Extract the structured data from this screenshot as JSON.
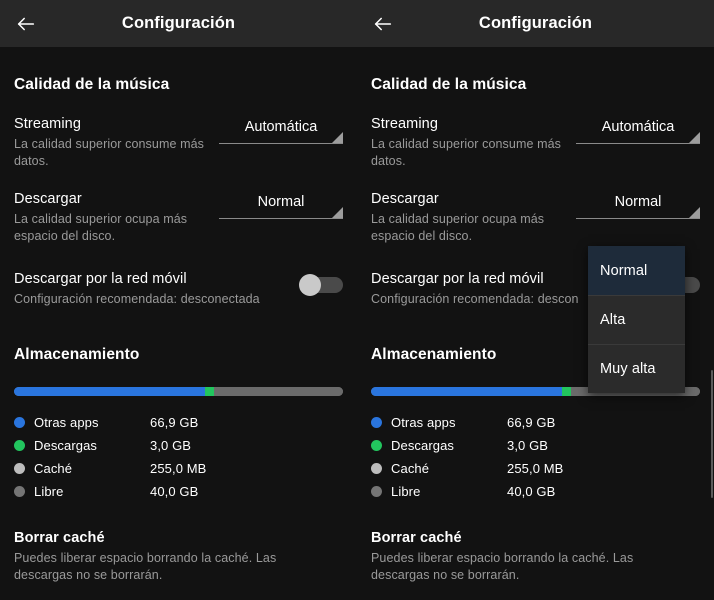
{
  "appbar": {
    "title": "Configuración",
    "back_icon": "arrow-left-icon"
  },
  "quality": {
    "section_title": "Calidad de la música",
    "rows": [
      {
        "title": "Streaming",
        "subtitle": "La calidad superior consume más datos.",
        "value": "Automática"
      },
      {
        "title": "Descargar",
        "subtitle": "La calidad superior ocupa más espacio del disco.",
        "value": "Normal"
      }
    ],
    "mobile_row": {
      "title": "Descargar por la red móvil",
      "subtitle": "Configuración recomendada: desconectada",
      "subtitle_clipped": "Configuración recomendada: descon",
      "toggle_state": "off"
    }
  },
  "storage": {
    "section_title": "Almacenamiento",
    "bar": [
      {
        "name": "Otras apps",
        "color": "#2a75de",
        "percent": 58.2
      },
      {
        "name": "Descargas",
        "color": "#22c55e",
        "percent": 2.6
      },
      {
        "name": "Caché",
        "color": "#6b6b6b",
        "percent": 0.2
      },
      {
        "name": "Libre",
        "color": "#6b6b6b",
        "percent": 39.0
      }
    ],
    "legend": [
      {
        "color": "#2a75de",
        "label": "Otras apps",
        "value": "66,9 GB"
      },
      {
        "color": "#22c55e",
        "label": "Descargas",
        "value": "3,0 GB"
      },
      {
        "color": "#bdbdbd",
        "label": "Caché",
        "value": "255,0 MB"
      },
      {
        "color": "#757575",
        "label": "Libre",
        "value": "40,0 GB"
      }
    ]
  },
  "cache": {
    "title": "Borrar caché",
    "subtitle": "Puedes liberar espacio borrando la caché. Las descargas no se borrarán."
  },
  "dropdown": {
    "open": true,
    "options": [
      "Normal",
      "Alta",
      "Muy alta"
    ],
    "selected": "Normal",
    "highlight_color": "#1e2b3a",
    "menu_background": "#2b2b2b"
  },
  "colors": {
    "page_background": "#121212",
    "appbar_background": "#282828",
    "primary_text": "#ffffff",
    "secondary_text": "#9a9a9a",
    "blue": "#2a75de",
    "green": "#22c55e"
  }
}
